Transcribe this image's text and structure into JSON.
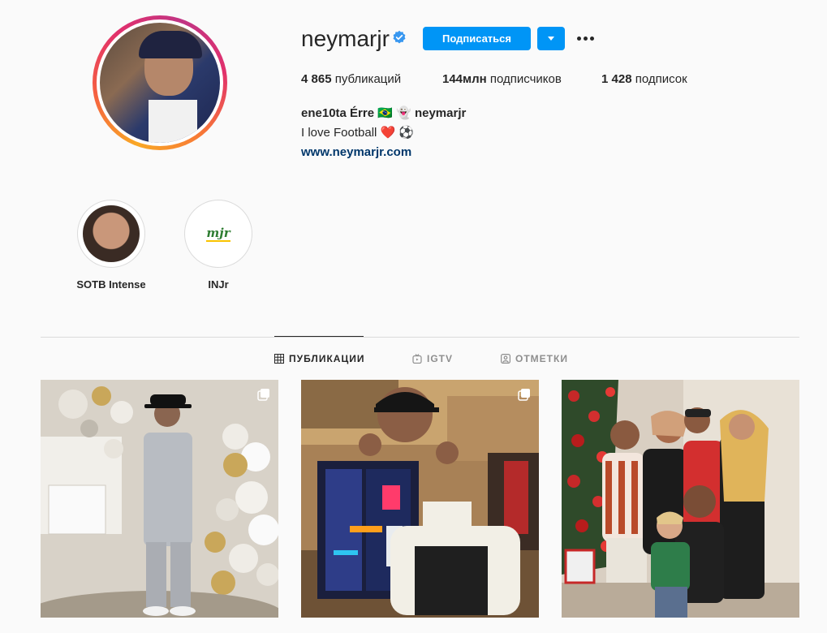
{
  "profile": {
    "username": "neymarjr",
    "follow_label": "Подписаться",
    "stats": {
      "posts_count": "4 865",
      "posts_label": "публикаций",
      "followers_count": "144млн",
      "followers_label": "подписчиков",
      "following_count": "1 428",
      "following_label": "подписок"
    },
    "bio": {
      "name": "ene10ta Érre",
      "flag": "🇧🇷",
      "ghost": "👻",
      "mention": "neymarjr",
      "line2": "I love Football",
      "heart": "❤️",
      "ball": "⚽",
      "link": "www.neymarjr.com"
    }
  },
  "highlights": [
    {
      "label": "SOTB Intense"
    },
    {
      "label": "INJr",
      "logo_text": "mjr"
    }
  ],
  "tabs": [
    {
      "label": "ПУБЛИКАЦИИ",
      "icon": "grid-icon",
      "active": true
    },
    {
      "label": "IGTV",
      "icon": "igtv-icon",
      "active": false
    },
    {
      "label": "ОТМЕТКИ",
      "icon": "tagged-icon",
      "active": false
    }
  ],
  "colors": {
    "accent": "#0095f6",
    "link": "#00376b",
    "text": "#262626",
    "muted": "#8e8e8e",
    "border": "#dbdbdb",
    "background": "#fafafa"
  }
}
